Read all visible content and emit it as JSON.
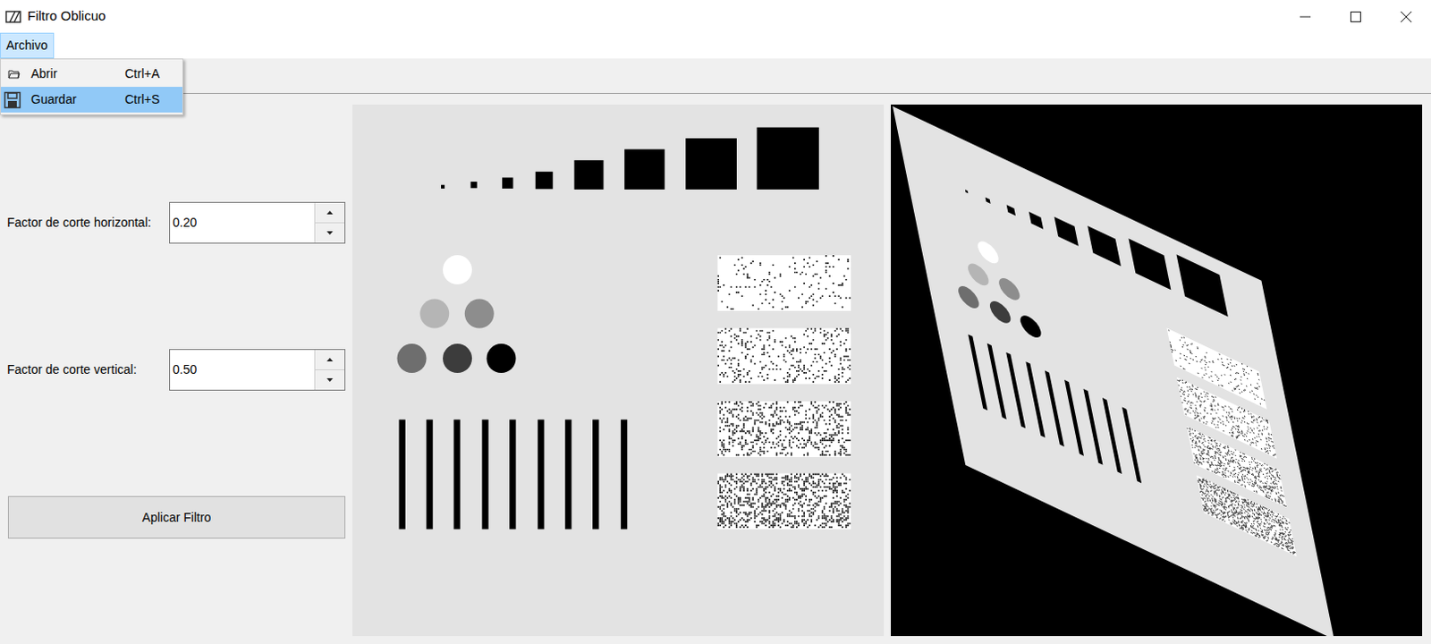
{
  "window": {
    "title": "Filtro Oblicuo"
  },
  "menubar": [
    {
      "label": "Archivo",
      "selected": true
    }
  ],
  "menu": {
    "items": [
      {
        "label": "Abrir",
        "shortcut": "Ctrl+A",
        "selected": false
      },
      {
        "label": "Guardar",
        "shortcut": "Ctrl+S",
        "selected": true
      }
    ]
  },
  "controls": [
    {
      "label": "Factor de corte horizontal:",
      "value": "0.20"
    },
    {
      "label": "Factor de corte vertical:",
      "value": "0.50"
    }
  ],
  "button": "Aplicar Filtro"
}
